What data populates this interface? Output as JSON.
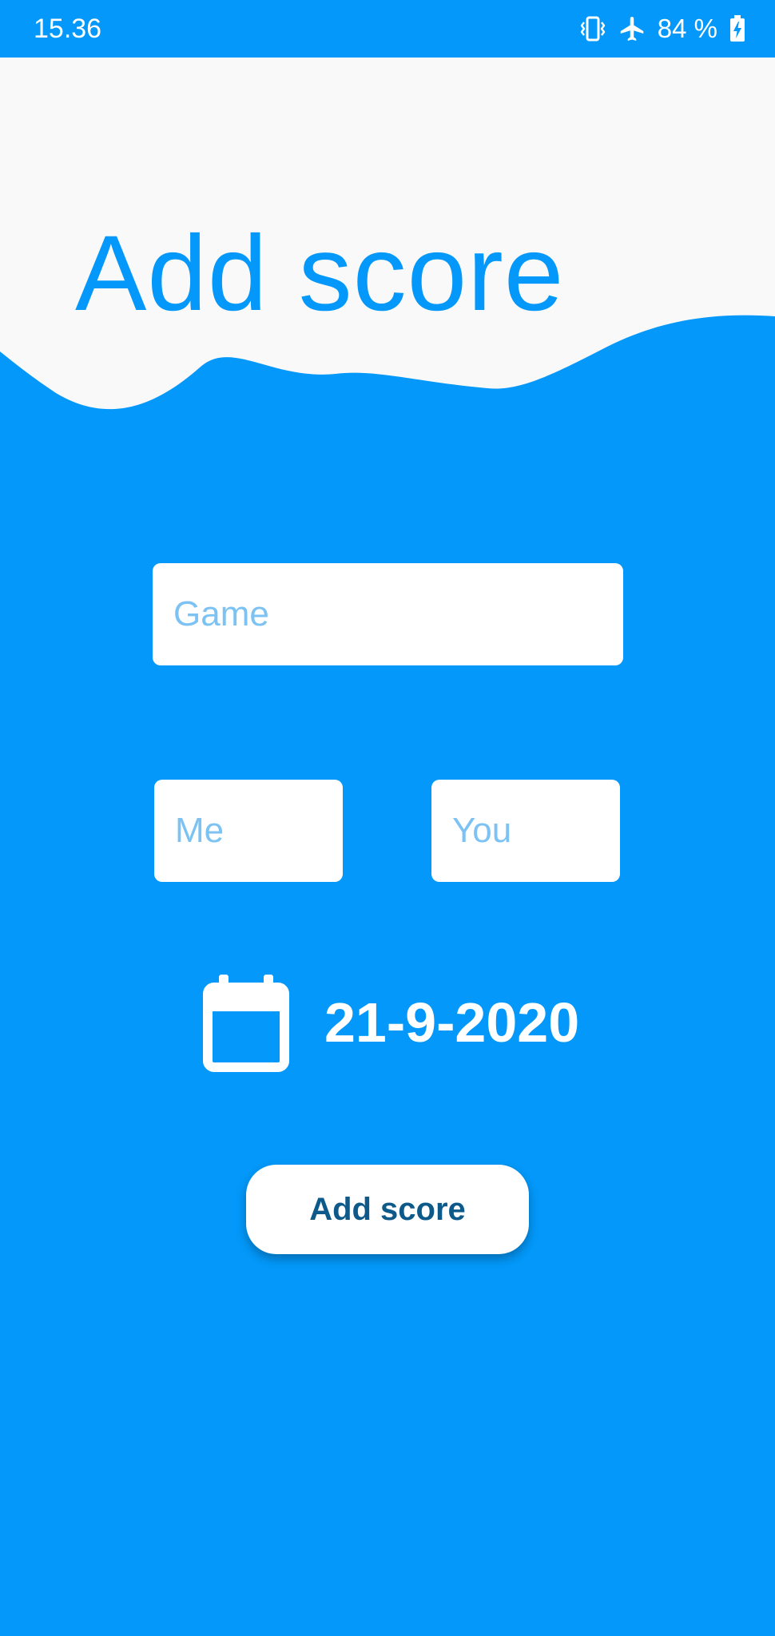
{
  "status_bar": {
    "time": "15.36",
    "battery_percent": "84 %",
    "icons": [
      "vibrate-icon",
      "airplane-mode-icon",
      "battery-charging-icon"
    ]
  },
  "header": {
    "title": "Add score"
  },
  "form": {
    "game_placeholder": "Game",
    "game_value": "",
    "me_placeholder": "Me",
    "me_value": "",
    "you_placeholder": "You",
    "you_value": "",
    "date": "21-9-2020",
    "date_icon": "calendar-icon",
    "submit_label": "Add score"
  },
  "colors": {
    "primary": "#0398f9",
    "header_background": "#f9f9f9",
    "input_background": "#ffffff",
    "placeholder": "#7cc2f3",
    "button_text": "#0d5a8a"
  }
}
